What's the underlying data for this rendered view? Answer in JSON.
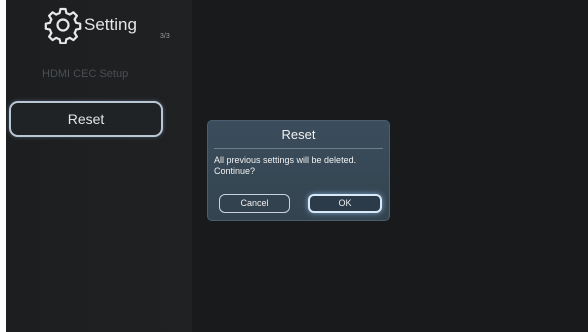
{
  "header": {
    "title": "Setting",
    "page_indicator": "3/3",
    "icon": "gear-icon"
  },
  "menu": {
    "items": [
      {
        "label": "HDMI CEC Setup",
        "state": "disabled"
      },
      {
        "label": "Reset",
        "state": "focused"
      }
    ]
  },
  "dialog": {
    "title": "Reset",
    "message": "All previous settings will be deleted. Continue?",
    "cancel_label": "Cancel",
    "ok_label": "OK"
  },
  "colors": {
    "background": "#191a1b",
    "dialog": "#3a4b5a",
    "focus_border": "#d9e9f8"
  }
}
